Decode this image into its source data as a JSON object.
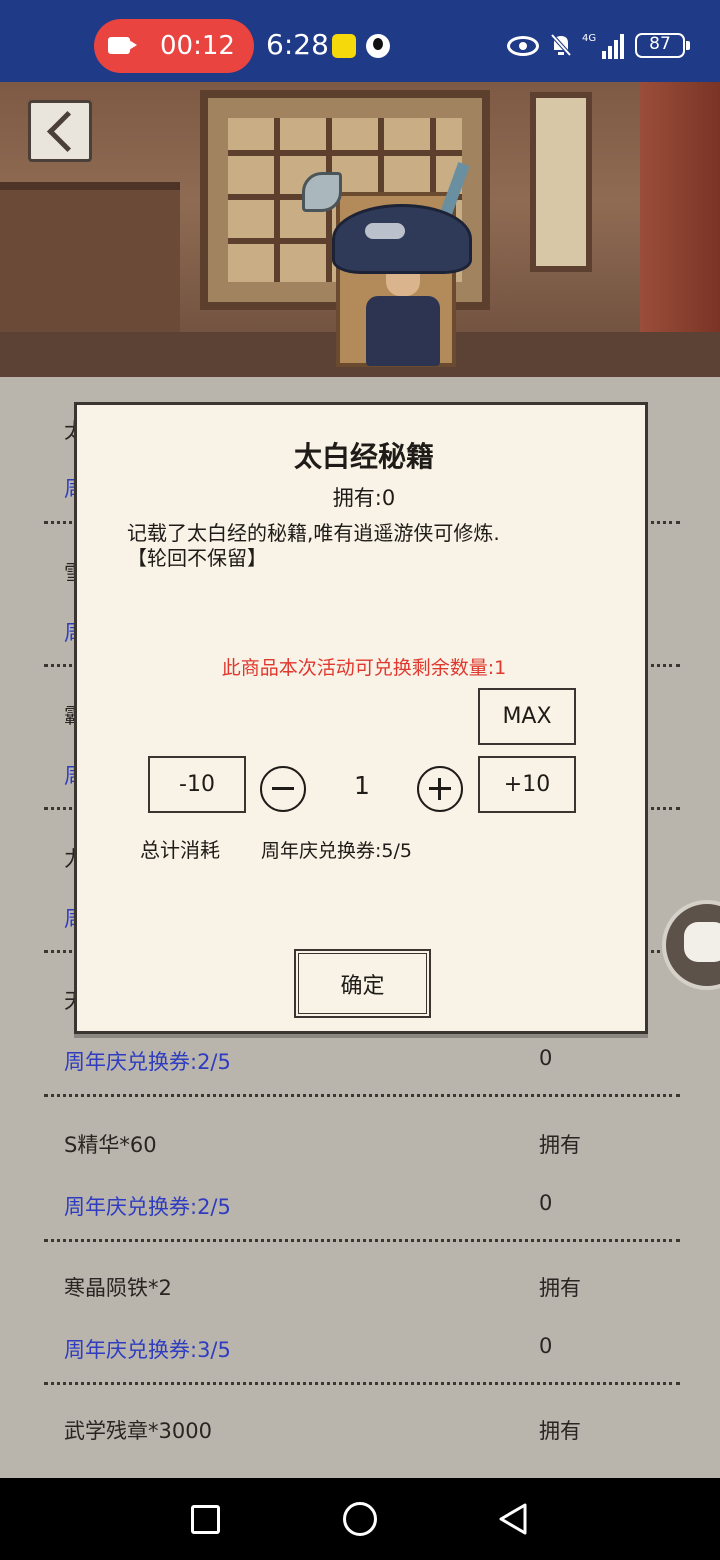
{
  "status_bar": {
    "recording_time": "00:12",
    "clock": "6:28",
    "battery": "87",
    "network": "4G"
  },
  "background_list": {
    "ghost_rows": [
      {
        "name": "太",
        "cost": "周"
      },
      {
        "name": "雪",
        "cost": "周"
      },
      {
        "name": "霸",
        "cost": "周"
      },
      {
        "name": "力",
        "cost": "周"
      },
      {
        "name": "天"
      }
    ],
    "rows": [
      {
        "name": "",
        "owned_label": "",
        "cost": "周年庆兑换券:2/5",
        "count": "0"
      },
      {
        "name": "S精华*60",
        "owned_label": "拥有",
        "cost": "周年庆兑换券:2/5",
        "count": "0"
      },
      {
        "name": "寒晶陨铁*2",
        "owned_label": "拥有",
        "cost": "周年庆兑换券:3/5",
        "count": "0"
      },
      {
        "name": "武学残章*3000",
        "owned_label": "拥有",
        "cost": "",
        "count": ""
      }
    ]
  },
  "modal": {
    "title": "太白经秘籍",
    "owned": "拥有:0",
    "description_line1": "记载了太白经的秘籍,唯有逍遥游侠可修炼.",
    "description_line2": "【轮回不保留】",
    "limit_text": "此商品本次活动可兑换剩余数量:1",
    "max_label": "MAX",
    "minus10_label": "-10",
    "plus10_label": "+10",
    "quantity": "1",
    "total_label": "总计消耗",
    "total_value": "周年庆兑换券:5/5",
    "confirm_label": "确定"
  },
  "icons": {
    "back": "back-arrow-icon",
    "record": "video-record-icon",
    "eye": "eye-icon",
    "mute": "bell-mute-icon",
    "signal": "signal-icon",
    "battery": "battery-icon"
  },
  "colors": {
    "status_bar": "#1f3a86",
    "record_pill": "#e9443f",
    "cost_text": "#2f3cc0",
    "limit_text": "#e0382f",
    "modal_bg": "#f8f3e6"
  }
}
